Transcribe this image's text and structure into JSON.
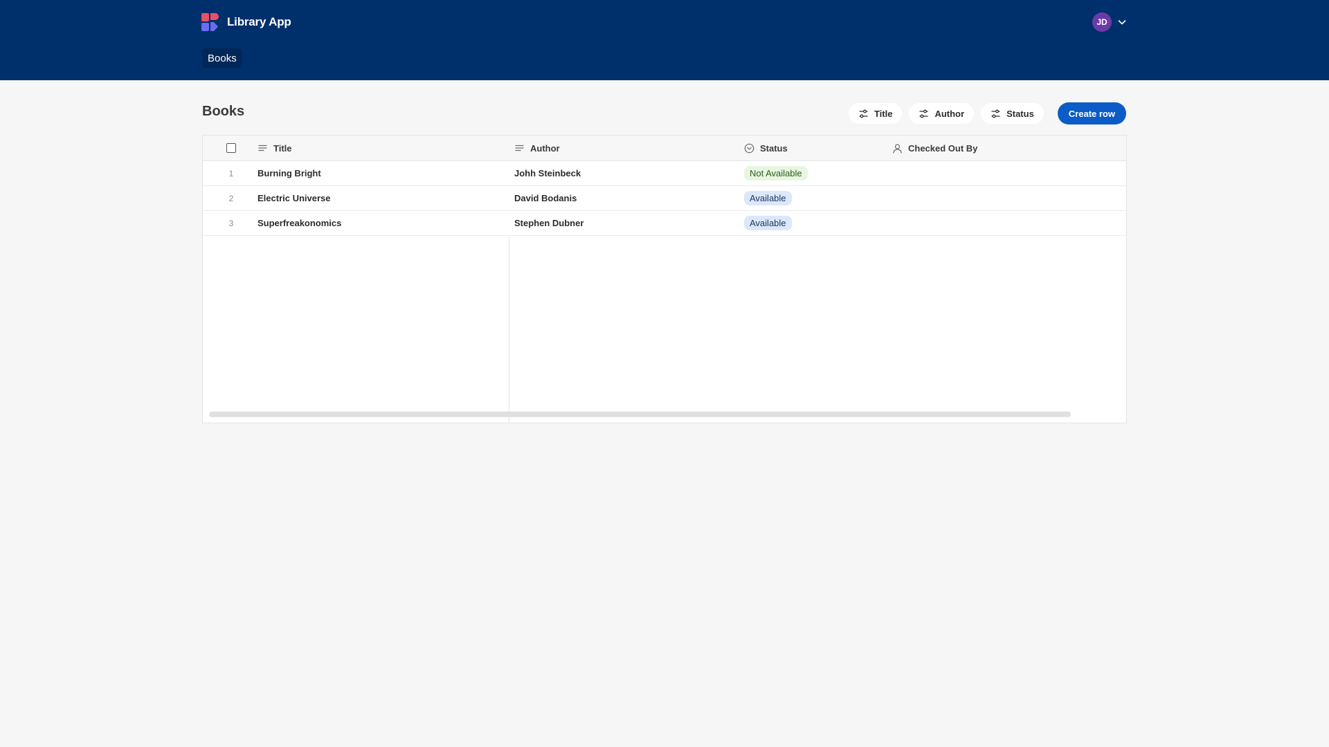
{
  "app": {
    "name": "Library App",
    "nav": {
      "books_tab": "Books"
    },
    "user": {
      "initials": "JD"
    },
    "colors": {
      "header": "#00306b",
      "primary": "#0b5cc6",
      "avatar": "#6c3aa7",
      "not_available_badge": "#e8f6e1",
      "available_badge": "#dbe7fb"
    }
  },
  "page": {
    "title": "Books",
    "filters": {
      "title": "Title",
      "author": "Author",
      "status": "Status"
    },
    "create_label": "Create row"
  },
  "table": {
    "headers": {
      "title": "Title",
      "author": "Author",
      "status": "Status",
      "checked_out_by": "Checked Out By"
    },
    "header_icons": {
      "title": "text-lines-icon",
      "author": "text-lines-icon",
      "status": "chevron-circle-icon",
      "checked_out_by": "person-icon"
    },
    "rows": [
      {
        "num": "1",
        "title": "Burning Bright",
        "author": "Johh Steinbeck",
        "status": "Not Available",
        "checked_out_by": ""
      },
      {
        "num": "2",
        "title": "Electric Universe",
        "author": "David Bodanis",
        "status": "Available",
        "checked_out_by": ""
      },
      {
        "num": "3",
        "title": "Superfreakonomics",
        "author": "Stephen Dubner",
        "status": "Available",
        "checked_out_by": ""
      }
    ]
  }
}
